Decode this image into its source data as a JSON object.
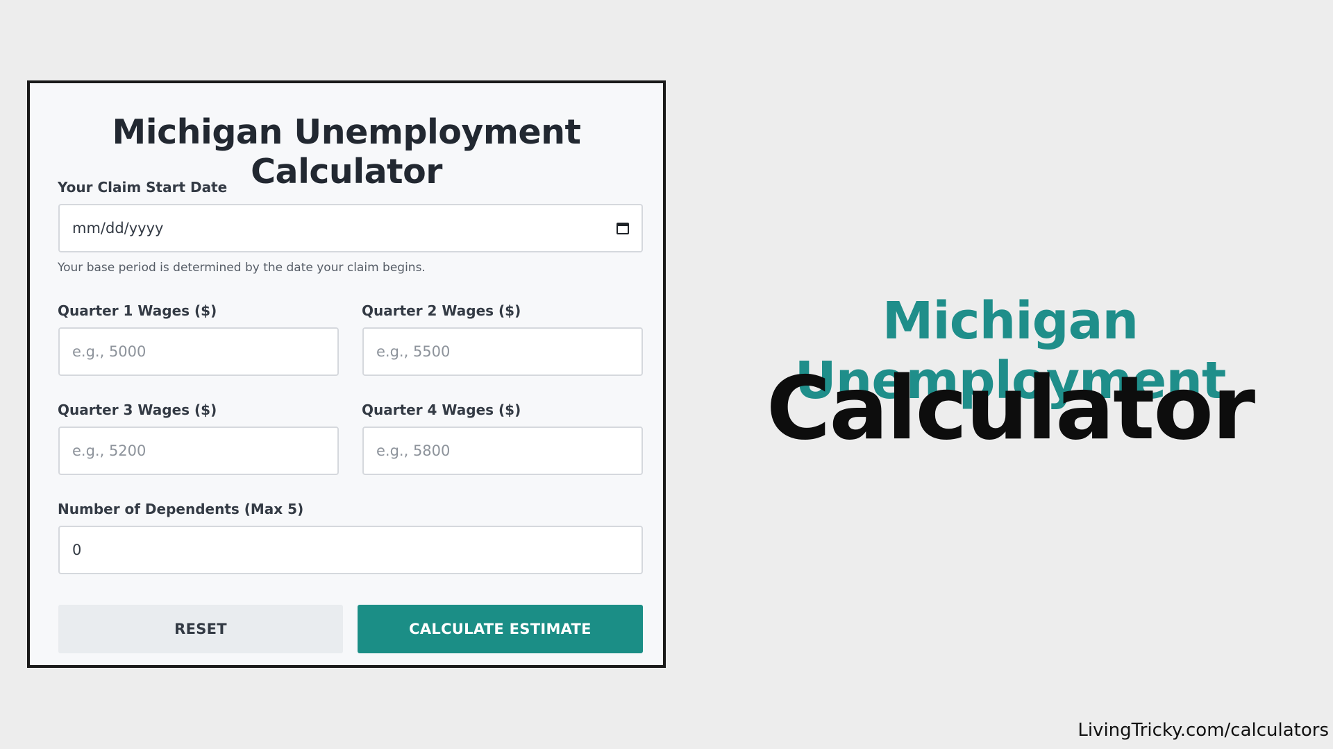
{
  "card": {
    "title": "Michigan Unemployment Calculator",
    "claim_date": {
      "label": "Your Claim Start Date",
      "value": "mm/dd/yyyy",
      "icon": "calendar-icon",
      "help": "Your base period is determined by the date your claim begins."
    },
    "quarters": [
      {
        "label": "Quarter 1 Wages ($)",
        "placeholder": "e.g., 5000"
      },
      {
        "label": "Quarter 2 Wages ($)",
        "placeholder": "e.g., 5500"
      },
      {
        "label": "Quarter 3 Wages ($)",
        "placeholder": "e.g., 5200"
      },
      {
        "label": "Quarter 4 Wages ($)",
        "placeholder": "e.g., 5800"
      }
    ],
    "dependents": {
      "label": "Number of Dependents (Max 5)",
      "value": "0"
    },
    "buttons": {
      "reset": "RESET",
      "calculate": "CALCULATE ESTIMATE"
    }
  },
  "hero": {
    "line1": "Michigan Unemployment",
    "line2": "Calculator"
  },
  "footer": {
    "link": "LivingTricky.com/calculators"
  },
  "colors": {
    "accent": "#1b8e86",
    "hero_teal": "#1f8e8a",
    "background": "#ededed"
  }
}
